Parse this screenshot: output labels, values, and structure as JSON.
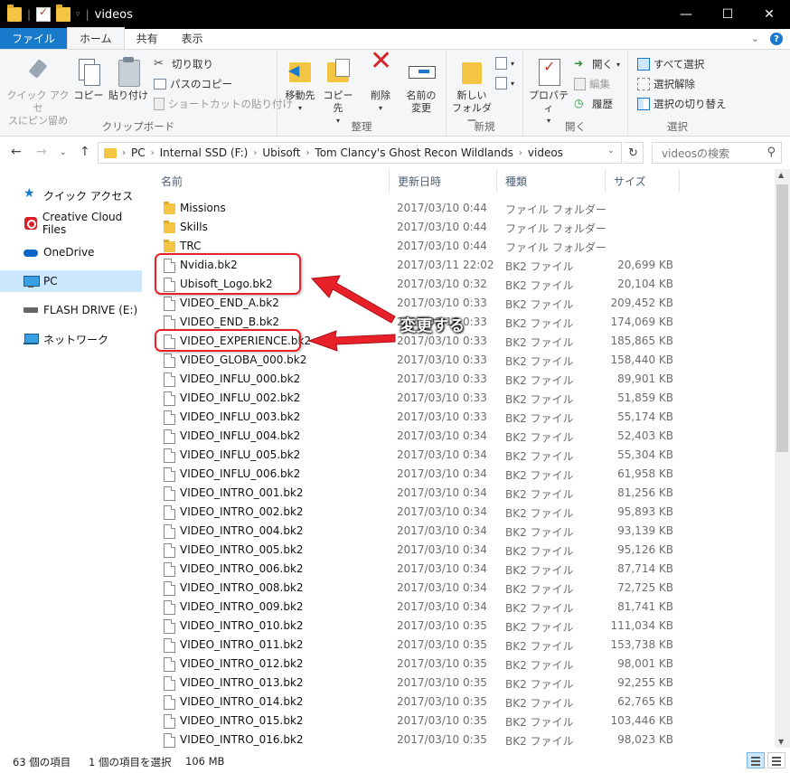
{
  "window": {
    "title": "videos",
    "controls": {
      "minimize": "—",
      "maximize": "☐",
      "close": "✕"
    }
  },
  "ribbon": {
    "tabs": [
      "ファイル",
      "ホーム",
      "共有",
      "表示"
    ],
    "clipboard": {
      "label": "クリップボード",
      "pin_line1": "クイック アクセ",
      "pin_line2": "スにピン留め",
      "copy": "コピー",
      "paste": "貼り付け",
      "cut": "切り取り",
      "copy_path": "パスのコピー",
      "paste_shortcut": "ショートカットの貼り付け"
    },
    "organize": {
      "label": "整理",
      "move_to": "移動先",
      "copy_to": "コピー先",
      "delete": "削除",
      "rename_line1": "名前の",
      "rename_line2": "変更"
    },
    "new": {
      "label": "新規",
      "new_folder_line1": "新しい",
      "new_folder_line2": "フォルダー"
    },
    "open": {
      "label": "開く",
      "properties": "プロパティ",
      "open": "開く",
      "edit": "編集",
      "history": "履歴"
    },
    "select": {
      "label": "選択",
      "select_all": "すべて選択",
      "select_none": "選択解除",
      "invert": "選択の切り替え"
    }
  },
  "address": {
    "segments": [
      "PC",
      "Internal SSD (F:)",
      "Ubisoft",
      "Tom Clancy's Ghost Recon Wildlands",
      "videos"
    ],
    "search_placeholder": "videosの検索"
  },
  "nav_pane": [
    {
      "label": "クイック アクセス",
      "icon": "star-icon"
    },
    {
      "label": "Creative Cloud Files",
      "icon": "creative-cloud-icon"
    },
    {
      "label": "OneDrive",
      "icon": "cloud-icon"
    },
    {
      "label": "PC",
      "icon": "computer-icon",
      "selected": true
    },
    {
      "label": "FLASH DRIVE (E:)",
      "icon": "usb-drive-icon"
    },
    {
      "label": "ネットワーク",
      "icon": "network-icon"
    }
  ],
  "columns": {
    "name": "名前",
    "date": "更新日時",
    "type": "種類",
    "size": "サイズ"
  },
  "files": [
    {
      "name": "Missions",
      "date": "2017/03/10 0:44",
      "type": "ファイル フォルダー",
      "size": "",
      "kind": "folder"
    },
    {
      "name": "Skills",
      "date": "2017/03/10 0:44",
      "type": "ファイル フォルダー",
      "size": "",
      "kind": "folder"
    },
    {
      "name": "TRC",
      "date": "2017/03/10 0:44",
      "type": "ファイル フォルダー",
      "size": "",
      "kind": "folder"
    },
    {
      "name": "Nvidia.bk2",
      "date": "2017/03/11 22:02",
      "type": "BK2 ファイル",
      "size": "20,699 KB",
      "kind": "file"
    },
    {
      "name": "Ubisoft_Logo.bk2",
      "date": "2017/03/10 0:32",
      "type": "BK2 ファイル",
      "size": "20,104 KB",
      "kind": "file"
    },
    {
      "name": "VIDEO_END_A.bk2",
      "date": "2017/03/10 0:33",
      "type": "BK2 ファイル",
      "size": "209,452 KB",
      "kind": "file"
    },
    {
      "name": "VIDEO_END_B.bk2",
      "date": "2017/03/10 0:33",
      "type": "BK2 ファイル",
      "size": "174,069 KB",
      "kind": "file"
    },
    {
      "name": "VIDEO_EXPERIENCE.bk2",
      "date": "2017/03/10 0:33",
      "type": "BK2 ファイル",
      "size": "185,865 KB",
      "kind": "file"
    },
    {
      "name": "VIDEO_GLOBA_000.bk2",
      "date": "2017/03/10 0:33",
      "type": "BK2 ファイル",
      "size": "158,440 KB",
      "kind": "file"
    },
    {
      "name": "VIDEO_INFLU_000.bk2",
      "date": "2017/03/10 0:33",
      "type": "BK2 ファイル",
      "size": "89,901 KB",
      "kind": "file"
    },
    {
      "name": "VIDEO_INFLU_002.bk2",
      "date": "2017/03/10 0:33",
      "type": "BK2 ファイル",
      "size": "51,859 KB",
      "kind": "file"
    },
    {
      "name": "VIDEO_INFLU_003.bk2",
      "date": "2017/03/10 0:33",
      "type": "BK2 ファイル",
      "size": "55,174 KB",
      "kind": "file"
    },
    {
      "name": "VIDEO_INFLU_004.bk2",
      "date": "2017/03/10 0:34",
      "type": "BK2 ファイル",
      "size": "52,403 KB",
      "kind": "file"
    },
    {
      "name": "VIDEO_INFLU_005.bk2",
      "date": "2017/03/10 0:34",
      "type": "BK2 ファイル",
      "size": "55,304 KB",
      "kind": "file"
    },
    {
      "name": "VIDEO_INFLU_006.bk2",
      "date": "2017/03/10 0:34",
      "type": "BK2 ファイル",
      "size": "61,958 KB",
      "kind": "file"
    },
    {
      "name": "VIDEO_INTRO_001.bk2",
      "date": "2017/03/10 0:34",
      "type": "BK2 ファイル",
      "size": "81,256 KB",
      "kind": "file"
    },
    {
      "name": "VIDEO_INTRO_002.bk2",
      "date": "2017/03/10 0:34",
      "type": "BK2 ファイル",
      "size": "95,893 KB",
      "kind": "file"
    },
    {
      "name": "VIDEO_INTRO_004.bk2",
      "date": "2017/03/10 0:34",
      "type": "BK2 ファイル",
      "size": "93,139 KB",
      "kind": "file"
    },
    {
      "name": "VIDEO_INTRO_005.bk2",
      "date": "2017/03/10 0:34",
      "type": "BK2 ファイル",
      "size": "95,126 KB",
      "kind": "file"
    },
    {
      "name": "VIDEO_INTRO_006.bk2",
      "date": "2017/03/10 0:34",
      "type": "BK2 ファイル",
      "size": "87,714 KB",
      "kind": "file"
    },
    {
      "name": "VIDEO_INTRO_008.bk2",
      "date": "2017/03/10 0:34",
      "type": "BK2 ファイル",
      "size": "72,725 KB",
      "kind": "file"
    },
    {
      "name": "VIDEO_INTRO_009.bk2",
      "date": "2017/03/10 0:34",
      "type": "BK2 ファイル",
      "size": "81,741 KB",
      "kind": "file"
    },
    {
      "name": "VIDEO_INTRO_010.bk2",
      "date": "2017/03/10 0:35",
      "type": "BK2 ファイル",
      "size": "111,034 KB",
      "kind": "file"
    },
    {
      "name": "VIDEO_INTRO_011.bk2",
      "date": "2017/03/10 0:35",
      "type": "BK2 ファイル",
      "size": "153,738 KB",
      "kind": "file"
    },
    {
      "name": "VIDEO_INTRO_012.bk2",
      "date": "2017/03/10 0:35",
      "type": "BK2 ファイル",
      "size": "98,001 KB",
      "kind": "file"
    },
    {
      "name": "VIDEO_INTRO_013.bk2",
      "date": "2017/03/10 0:35",
      "type": "BK2 ファイル",
      "size": "92,255 KB",
      "kind": "file"
    },
    {
      "name": "VIDEO_INTRO_014.bk2",
      "date": "2017/03/10 0:35",
      "type": "BK2 ファイル",
      "size": "62,765 KB",
      "kind": "file"
    },
    {
      "name": "VIDEO_INTRO_015.bk2",
      "date": "2017/03/10 0:35",
      "type": "BK2 ファイル",
      "size": "103,446 KB",
      "kind": "file"
    },
    {
      "name": "VIDEO_INTRO_016.bk2",
      "date": "2017/03/10 0:35",
      "type": "BK2 ファイル",
      "size": "98,023 KB",
      "kind": "file"
    }
  ],
  "annotation": {
    "label": "変更する",
    "color": "#e8202a"
  },
  "status": {
    "item_count": "63 個の項目",
    "selection": "1 個の項目を選択",
    "selection_size": "106 MB"
  }
}
